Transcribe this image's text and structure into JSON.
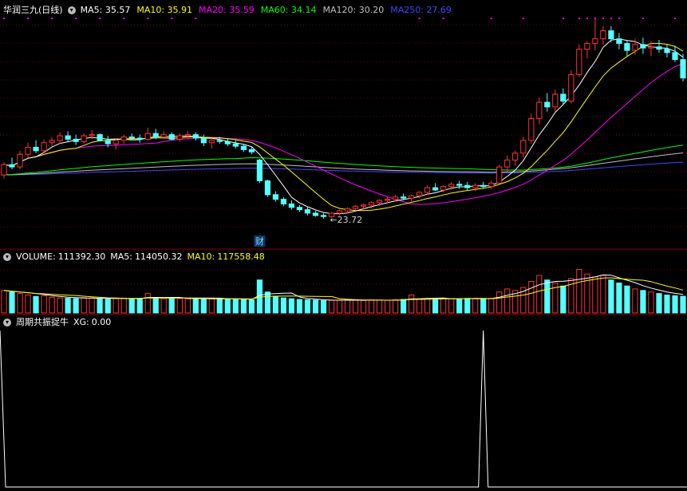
{
  "stock": {
    "title": "华润三九(日线)",
    "ma": [
      {
        "label": "MA5:",
        "value": "35.57",
        "color": "#ffffff"
      },
      {
        "label": "MA10:",
        "value": "35.91",
        "color": "#ffff00"
      },
      {
        "label": "MA20:",
        "value": "35.59",
        "color": "#ff00ff"
      },
      {
        "label": "MA60:",
        "value": "34.14",
        "color": "#00ff00"
      },
      {
        "label": "MA120:",
        "value": "30.20",
        "color": "#c0c0c0"
      },
      {
        "label": "MA250:",
        "value": "27.69",
        "color": "#4444ff"
      }
    ],
    "low_annotation": "23.72",
    "event_marker": "财"
  },
  "volume": {
    "title": "VOLUME:",
    "value": "111392.30",
    "ma5_label": "MA5:",
    "ma5_value": "114050.32",
    "ma10_label": "MA10:",
    "ma10_value": "117558.48"
  },
  "indicator": {
    "title": "周期共振捉牛",
    "xg_label": "XG:",
    "xg_value": "0.00"
  },
  "colors": {
    "up": "#ff3232",
    "down": "#54ffff",
    "grid": "#7a0000",
    "ma5": "#ffffff",
    "ma10": "#ffff00",
    "ma20": "#ff00ff",
    "ma60": "#00ff00",
    "ma120": "#c0c0c0",
    "ma250": "#4444ff"
  },
  "chart_data": [
    {
      "type": "candlestick",
      "ylim": [
        21.5,
        41
      ],
      "ohlc": [
        [
          27.5,
          28.6,
          27.2,
          28.4
        ],
        [
          28.4,
          29.0,
          28.0,
          28.2
        ],
        [
          28.2,
          29.6,
          28.0,
          29.3
        ],
        [
          29.3,
          30.3,
          29.0,
          29.9
        ],
        [
          29.9,
          30.5,
          29.4,
          29.6
        ],
        [
          29.6,
          30.6,
          29.4,
          30.3
        ],
        [
          30.3,
          30.8,
          30.0,
          30.5
        ],
        [
          30.5,
          31.2,
          30.2,
          30.9
        ],
        [
          30.9,
          31.3,
          30.4,
          30.6
        ],
        [
          30.6,
          31.0,
          30.1,
          30.4
        ],
        [
          30.4,
          31.1,
          30.2,
          30.9
        ],
        [
          30.9,
          31.4,
          30.6,
          31.0
        ],
        [
          31.0,
          31.1,
          30.4,
          30.5
        ],
        [
          30.5,
          30.9,
          29.9,
          30.2
        ],
        [
          30.2,
          30.7,
          29.7,
          30.5
        ],
        [
          30.5,
          31.0,
          30.2,
          30.8
        ],
        [
          30.8,
          31.1,
          30.5,
          30.7
        ],
        [
          30.7,
          31.0,
          30.3,
          30.6
        ],
        [
          30.6,
          31.6,
          30.5,
          31.1
        ],
        [
          31.1,
          31.5,
          30.6,
          30.8
        ],
        [
          30.8,
          31.3,
          30.6,
          31.0
        ],
        [
          31.0,
          31.2,
          30.5,
          30.6
        ],
        [
          30.6,
          31.1,
          30.4,
          30.9
        ],
        [
          30.9,
          31.3,
          30.6,
          31.0
        ],
        [
          31.0,
          31.2,
          30.5,
          30.7
        ],
        [
          30.7,
          31.0,
          30.0,
          30.3
        ],
        [
          30.3,
          30.7,
          29.8,
          30.5
        ],
        [
          30.5,
          30.8,
          30.2,
          30.4
        ],
        [
          30.4,
          30.7,
          30.0,
          30.2
        ],
        [
          30.2,
          30.5,
          29.8,
          30.0
        ],
        [
          30.0,
          30.2,
          29.5,
          29.7
        ],
        [
          29.7,
          30.0,
          29.3,
          29.5
        ],
        [
          28.8,
          28.9,
          26.8,
          27.0
        ],
        [
          27.0,
          27.1,
          25.6,
          25.8
        ],
        [
          25.8,
          26.1,
          25.2,
          25.4
        ],
        [
          25.4,
          25.6,
          24.8,
          25.0
        ],
        [
          25.0,
          25.3,
          24.5,
          24.7
        ],
        [
          24.7,
          24.9,
          24.3,
          24.5
        ],
        [
          24.5,
          24.7,
          24.0,
          24.2
        ],
        [
          24.2,
          24.4,
          23.9,
          24.0
        ],
        [
          24.0,
          24.2,
          23.72,
          23.9
        ],
        [
          23.9,
          24.3,
          23.8,
          24.2
        ],
        [
          24.2,
          24.5,
          24.0,
          24.4
        ],
        [
          24.4,
          24.7,
          24.2,
          24.6
        ],
        [
          24.6,
          24.9,
          24.4,
          24.8
        ],
        [
          24.8,
          25.0,
          24.5,
          24.9
        ],
        [
          24.9,
          25.2,
          24.6,
          25.1
        ],
        [
          25.1,
          25.4,
          24.8,
          25.3
        ],
        [
          25.3,
          25.6,
          25.0,
          25.4
        ],
        [
          25.4,
          25.8,
          25.2,
          25.6
        ],
        [
          25.6,
          25.9,
          25.3,
          25.5
        ],
        [
          25.5,
          25.8,
          25.2,
          25.7
        ],
        [
          25.7,
          26.1,
          25.5,
          26.0
        ],
        [
          26.0,
          26.6,
          25.8,
          26.4
        ],
        [
          26.4,
          26.8,
          26.1,
          26.2
        ],
        [
          26.2,
          26.6,
          26.0,
          26.5
        ],
        [
          26.5,
          26.9,
          26.2,
          26.7
        ],
        [
          26.7,
          27.0,
          26.3,
          26.6
        ],
        [
          26.6,
          26.9,
          26.2,
          26.4
        ],
        [
          26.4,
          26.8,
          26.1,
          26.6
        ],
        [
          26.6,
          26.9,
          26.3,
          26.5
        ],
        [
          26.5,
          27.0,
          26.3,
          26.8
        ],
        [
          26.8,
          28.4,
          26.7,
          28.2
        ],
        [
          28.2,
          29.2,
          27.8,
          28.8
        ],
        [
          28.8,
          29.6,
          28.3,
          29.4
        ],
        [
          29.4,
          30.8,
          29.0,
          30.5
        ],
        [
          30.5,
          32.8,
          30.2,
          32.4
        ],
        [
          32.4,
          34.2,
          31.9,
          33.8
        ],
        [
          33.8,
          34.6,
          33.0,
          33.4
        ],
        [
          33.4,
          34.9,
          33.0,
          34.5
        ],
        [
          34.5,
          35.0,
          33.6,
          33.9
        ],
        [
          33.9,
          36.6,
          33.7,
          36.2
        ],
        [
          36.2,
          38.8,
          36.0,
          38.4
        ],
        [
          38.4,
          39.1,
          37.6,
          38.9
        ],
        [
          38.9,
          41.0,
          38.3,
          39.3
        ],
        [
          39.3,
          40.4,
          38.8,
          40.0
        ],
        [
          40.0,
          40.4,
          39.0,
          39.3
        ],
        [
          39.3,
          39.8,
          38.4,
          38.9
        ],
        [
          38.9,
          39.2,
          37.8,
          38.3
        ],
        [
          38.3,
          39.3,
          37.9,
          38.8
        ],
        [
          38.8,
          39.4,
          38.0,
          38.5
        ],
        [
          38.5,
          39.1,
          37.8,
          38.6
        ],
        [
          38.6,
          39.2,
          38.1,
          38.4
        ],
        [
          38.4,
          38.8,
          37.7,
          38.1
        ],
        [
          38.1,
          38.7,
          37.3,
          37.5
        ],
        [
          37.5,
          38.0,
          35.6,
          35.9
        ]
      ]
    },
    {
      "type": "bar",
      "ylim": [
        0,
        330000
      ],
      "values": [
        150000,
        140000,
        130000,
        120000,
        110000,
        115000,
        105000,
        100000,
        98000,
        96000,
        102000,
        100000,
        95000,
        92000,
        96000,
        98000,
        95000,
        97000,
        130000,
        98000,
        96000,
        99000,
        97000,
        95000,
        93000,
        96000,
        94000,
        92000,
        95000,
        93000,
        90000,
        88000,
        220000,
        140000,
        110000,
        100000,
        95000,
        90000,
        88000,
        85000,
        82000,
        84000,
        86000,
        88000,
        85000,
        83000,
        87000,
        86000,
        84000,
        88000,
        90000,
        120000,
        92000,
        94000,
        96000,
        98000,
        95000,
        93000,
        97000,
        94000,
        96000,
        98000,
        140000,
        160000,
        150000,
        170000,
        210000,
        250000,
        220000,
        200000,
        180000,
        230000,
        290000,
        260000,
        240000,
        250000,
        220000,
        200000,
        180000,
        160000,
        150000,
        140000,
        130000,
        120000,
        115000,
        111392.3
      ]
    },
    {
      "type": "line",
      "ylim": [
        0,
        1
      ],
      "signal_indices": [
        0,
        60,
        87
      ]
    }
  ]
}
